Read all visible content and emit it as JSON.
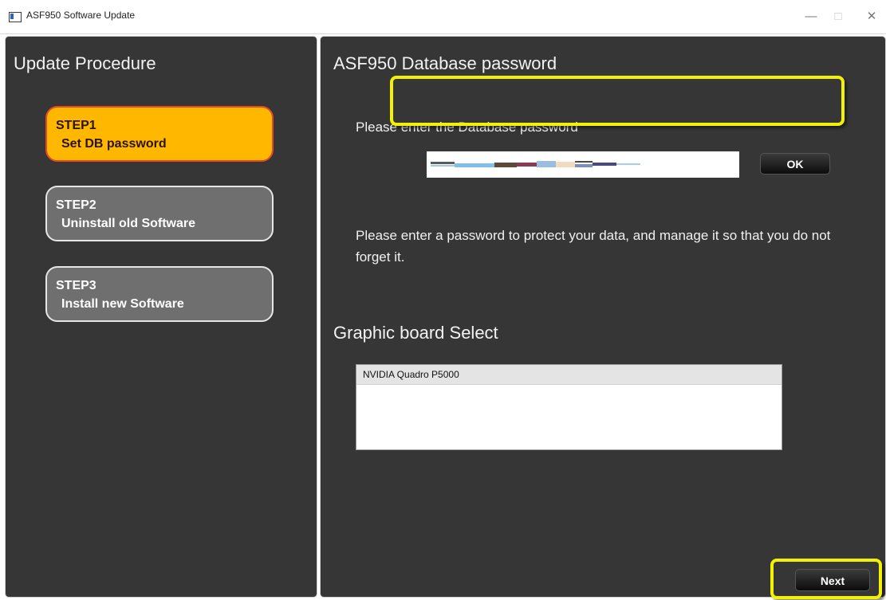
{
  "window": {
    "title": "ASF950 Software Update",
    "minimize_glyph": "—",
    "maximize_glyph": "□",
    "close_glyph": "✕"
  },
  "sidebar": {
    "heading": "Update Procedure",
    "steps": [
      {
        "num": "STEP1",
        "label": "Set DB password",
        "active": true
      },
      {
        "num": "STEP2",
        "label": "Uninstall old Software",
        "active": false
      },
      {
        "num": "STEP3",
        "label": "Install new Software",
        "active": false
      }
    ]
  },
  "main": {
    "db_heading": "ASF950  Database password",
    "db_prompt": "Please enter the Database password",
    "password_value": "",
    "ok_label": "OK",
    "info_text": "Please enter a password to protect your data, and manage it so that you do not forget it.",
    "gpu_heading": "Graphic board Select",
    "gpu_items": [
      "NVIDIA Quadro P5000"
    ],
    "next_label": "Next"
  },
  "colors": {
    "panel_bg": "#363636",
    "active_step": "#ffb700",
    "active_step_border": "#e24a2a",
    "inactive_step": "#6f6f6f",
    "highlight": "#f2f200"
  }
}
